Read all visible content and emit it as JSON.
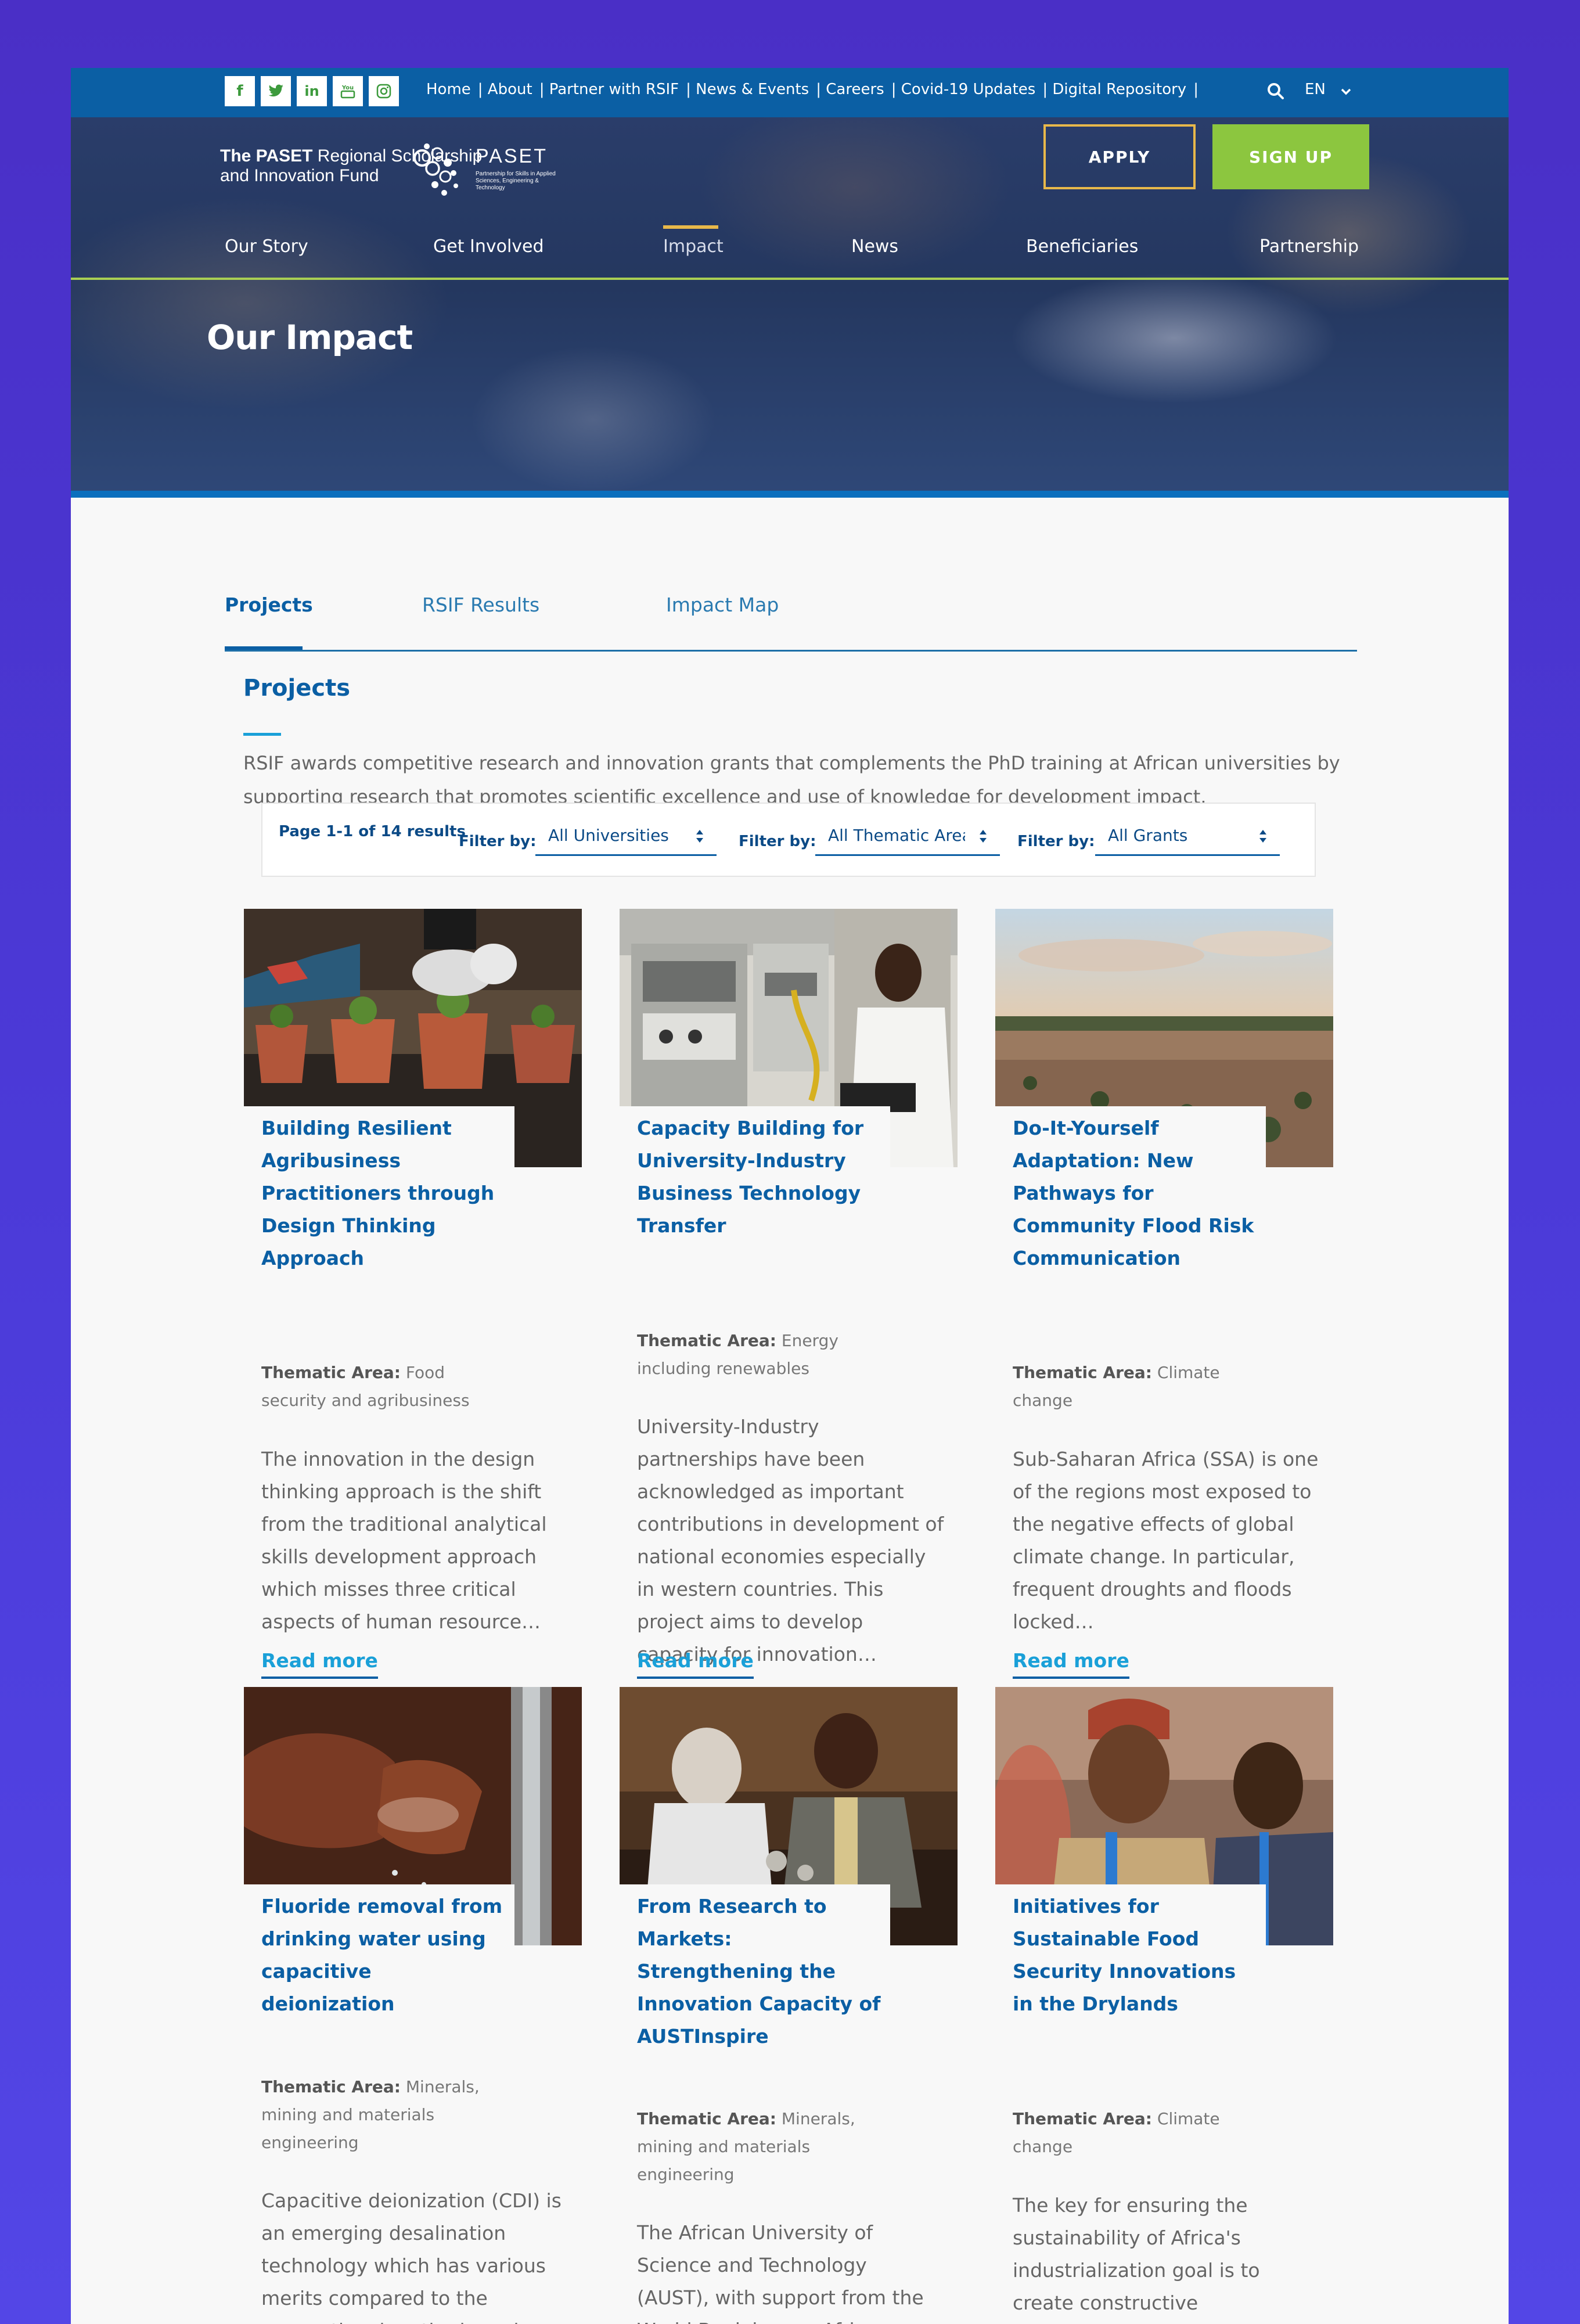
{
  "social": {
    "facebook": "f",
    "twitter": "t",
    "linkedin": "in",
    "youtube": "You",
    "instagram": "ig"
  },
  "top_links": [
    "Home",
    "| About",
    "| Partner with RSIF",
    "| News & Events",
    "| Careers",
    "| Covid-19 Updates",
    "| Digital Repository",
    "|"
  ],
  "language": "EN",
  "logo": {
    "line1_bold": "The PASET",
    "line1_rest": " Regional Scholarship",
    "line2": "and Innovation Fund",
    "paset": "PASET",
    "tagline": "Partnership for Skills in Applied Sciences, Engineering & Technology"
  },
  "header_buttons": {
    "apply": "APPLY",
    "signup": "SIGN UP"
  },
  "main_nav": [
    "Our Story",
    "Get Involved",
    "Impact",
    "News",
    "Beneficiaries",
    "Partnership"
  ],
  "page_heading": "Our Impact",
  "tabs": [
    "Projects",
    "RSIF Results",
    "Impact Map"
  ],
  "section": {
    "title": "Projects",
    "intro": "RSIF awards competitive research and innovation grants that complements the PhD training at African universities by supporting research that promotes scientific excellence and use of knowledge for development impact."
  },
  "filters": {
    "results": "Page 1-1 of 14 results",
    "label": "Filter by:",
    "universities": "All Universities",
    "thematic": "All Thematic Areas",
    "grants": "All Grants"
  },
  "thematic_label": "Thematic Area:",
  "read_more": "Read more",
  "cards": [
    {
      "title": "Building Resilient Agribusiness Practitioners through Design Thinking Approach",
      "thematic": "Food security and agribusiness",
      "desc": "The innovation in the design thinking approach is the shift from the traditional analytical skills development approach which misses three critical aspects of human resource…"
    },
    {
      "title": "Capacity Building for University-Industry Business Technology Transfer",
      "thematic": "Energy including renewables",
      "desc": "University-Industry partnerships have been acknowledged as important contributions in development of national economies especially in western countries. This project aims to develop capacity for innovation…"
    },
    {
      "title": "Do-It-Yourself Adaptation: New Pathways for Community Flood Risk Communication",
      "thematic": "Climate change",
      "desc": "Sub-Saharan Africa (SSA) is one of the regions most exposed to the negative effects of global climate change. In particular, frequent droughts and floods locked…"
    },
    {
      "title": "Fluoride removal from drinking water using capacitive deionization",
      "thematic": "Minerals, mining and materials engineering",
      "desc": "Capacitive deionization (CDI) is an emerging desalination technology which has various merits compared to the conventional methods such as reverse osmosis and thermally based…"
    },
    {
      "title": "From Research to Markets: Strengthening the Innovation Capacity of AUSTInspire",
      "thematic": "Minerals, mining and materials engineering",
      "desc": "The African University of Science and Technology (AUST), with support from the World Bank has an African Centre of Excellence (ACE) in Materials – Pan African…"
    },
    {
      "title": "Initiatives for Sustainable Food Security Innovations in the Drylands",
      "thematic": "Climate change",
      "desc": "The key for ensuring the sustainability of Africa's industrialization goal is to create constructive partnerships between academic institutions and private sector to facilitate…"
    }
  ],
  "colors": {
    "brand_blue": "#0b5fa4",
    "accent_green": "#8cc63f",
    "accent_gold": "#e8b84a",
    "link_cyan": "#1aa0d8"
  }
}
